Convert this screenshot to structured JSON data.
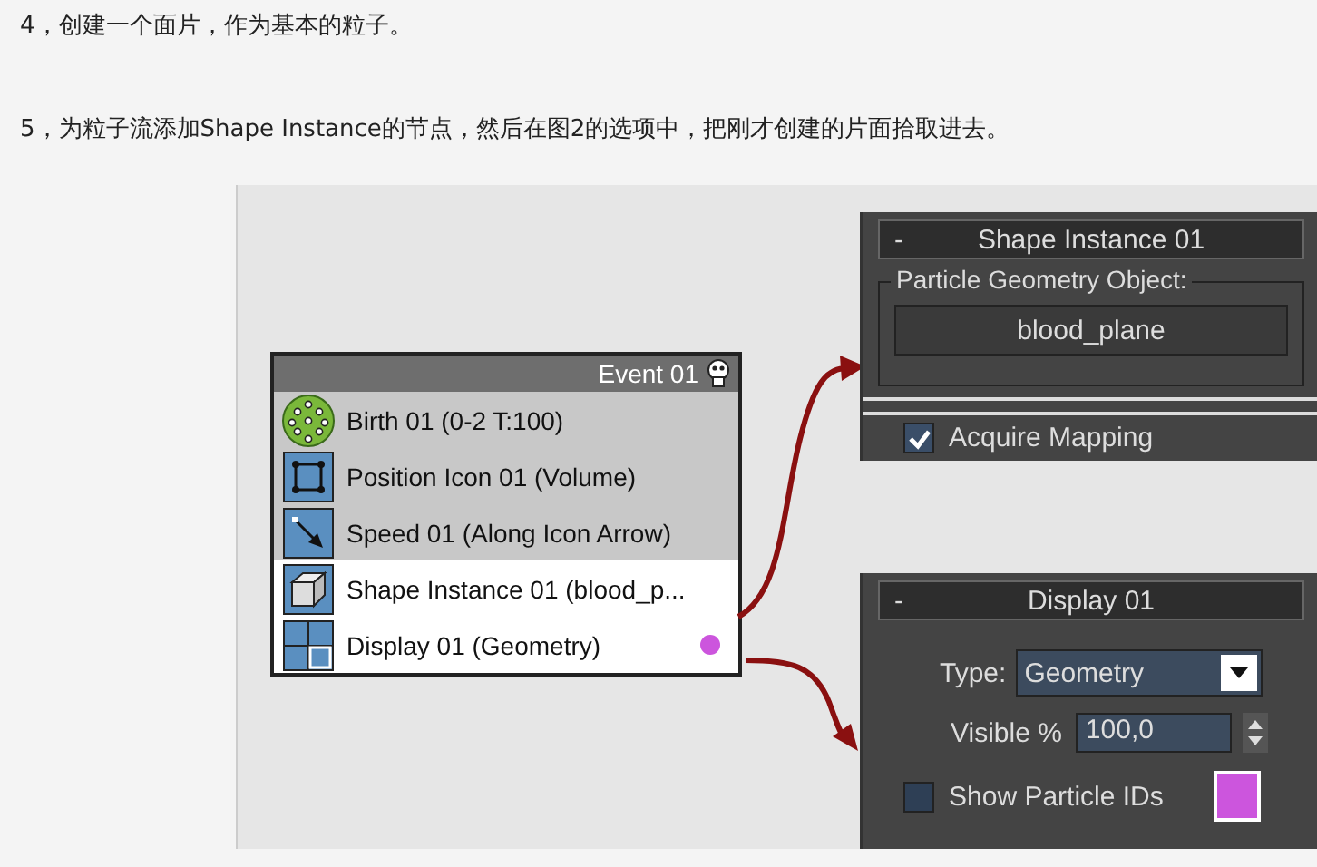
{
  "post": {
    "paragraphs": [
      "4，创建一个面片，作为基本的粒子。",
      "5，为粒子流添加Shape Instance的节点，然后在图2的选项中，把刚才创建的片面拾取进去。"
    ]
  },
  "figure": {
    "event": {
      "title": "Event 01",
      "operators": [
        {
          "kind": "birth",
          "label": "Birth 01 (0-2 T:100)",
          "selected": false
        },
        {
          "kind": "position",
          "label": "Position Icon 01 (Volume)",
          "selected": false
        },
        {
          "kind": "speed",
          "label": "Speed 01 (Along Icon Arrow)",
          "selected": false
        },
        {
          "kind": "shape",
          "label": "Shape Instance 01 (blood_p...",
          "selected": true
        },
        {
          "kind": "display",
          "label": "Display 01 (Geometry)",
          "selected": true,
          "color": "#cc55dd"
        }
      ]
    },
    "shape_panel": {
      "collapse": "-",
      "title": "Shape Instance 01",
      "group_label": "Particle Geometry Object:",
      "object_button": "blood_plane",
      "acquire_mapping": {
        "label": "Acquire Mapping",
        "checked": true
      }
    },
    "display_panel": {
      "collapse": "-",
      "title": "Display 01",
      "type_label": "Type:",
      "type_value": "Geometry",
      "visible_label": "Visible %",
      "visible_value": "100,0",
      "show_ids": {
        "label": "Show Particle IDs",
        "checked": false
      },
      "color": "#cc55dd"
    }
  }
}
